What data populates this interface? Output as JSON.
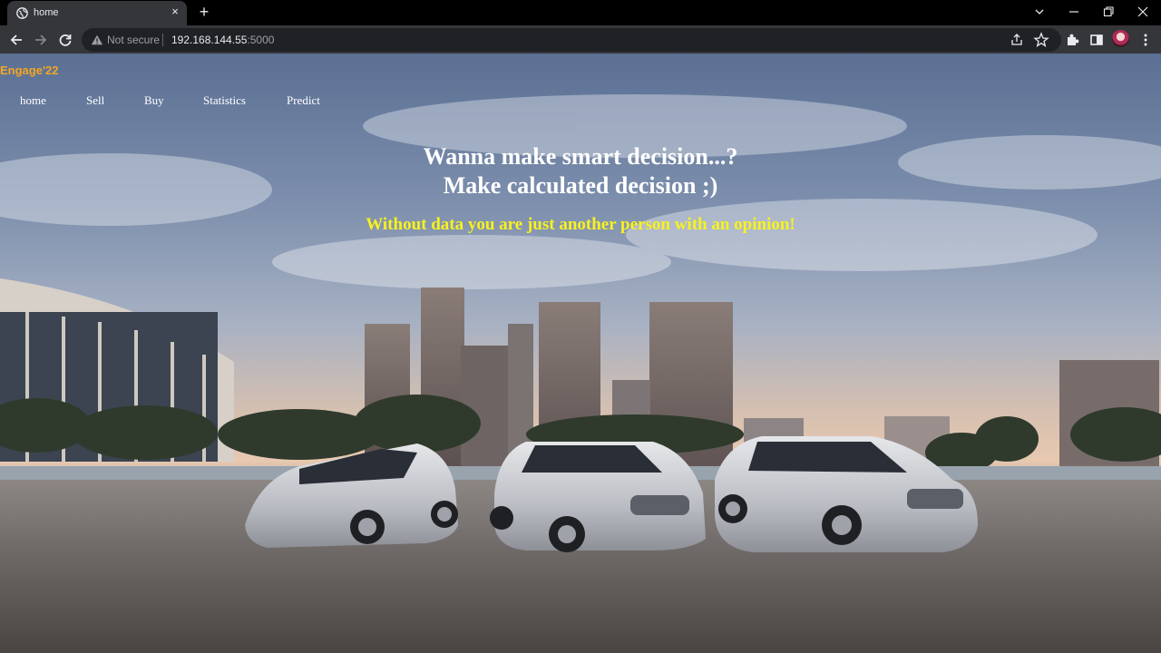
{
  "browser": {
    "tab_title": "home",
    "tab_close": "×",
    "new_tab": "+",
    "security_label": "Not secure",
    "url_host": "192.168.144.55",
    "url_port": ":5000",
    "icons": [
      "globe-icon",
      "back-icon",
      "forward-icon",
      "reload-icon",
      "warning-icon",
      "share-icon",
      "star-icon",
      "extensions-icon",
      "side-panel-icon",
      "menu-icon",
      "chevron-down-icon",
      "minimize-icon",
      "restore-icon",
      "close-icon"
    ]
  },
  "page": {
    "brand": "Engage'22",
    "nav": [
      {
        "label": "home"
      },
      {
        "label": "Sell"
      },
      {
        "label": "Buy"
      },
      {
        "label": "Statistics"
      },
      {
        "label": "Predict"
      }
    ],
    "headline_1": "Wanna make smart decision...?",
    "headline_2": "Make calculated decision ;)",
    "tagline": "Without data you are just another person with an opinion!",
    "colors": {
      "brand": "#f5a623",
      "nav_text": "#ffffff",
      "headline": "#ffffff",
      "tagline": "#f8f21e"
    }
  }
}
